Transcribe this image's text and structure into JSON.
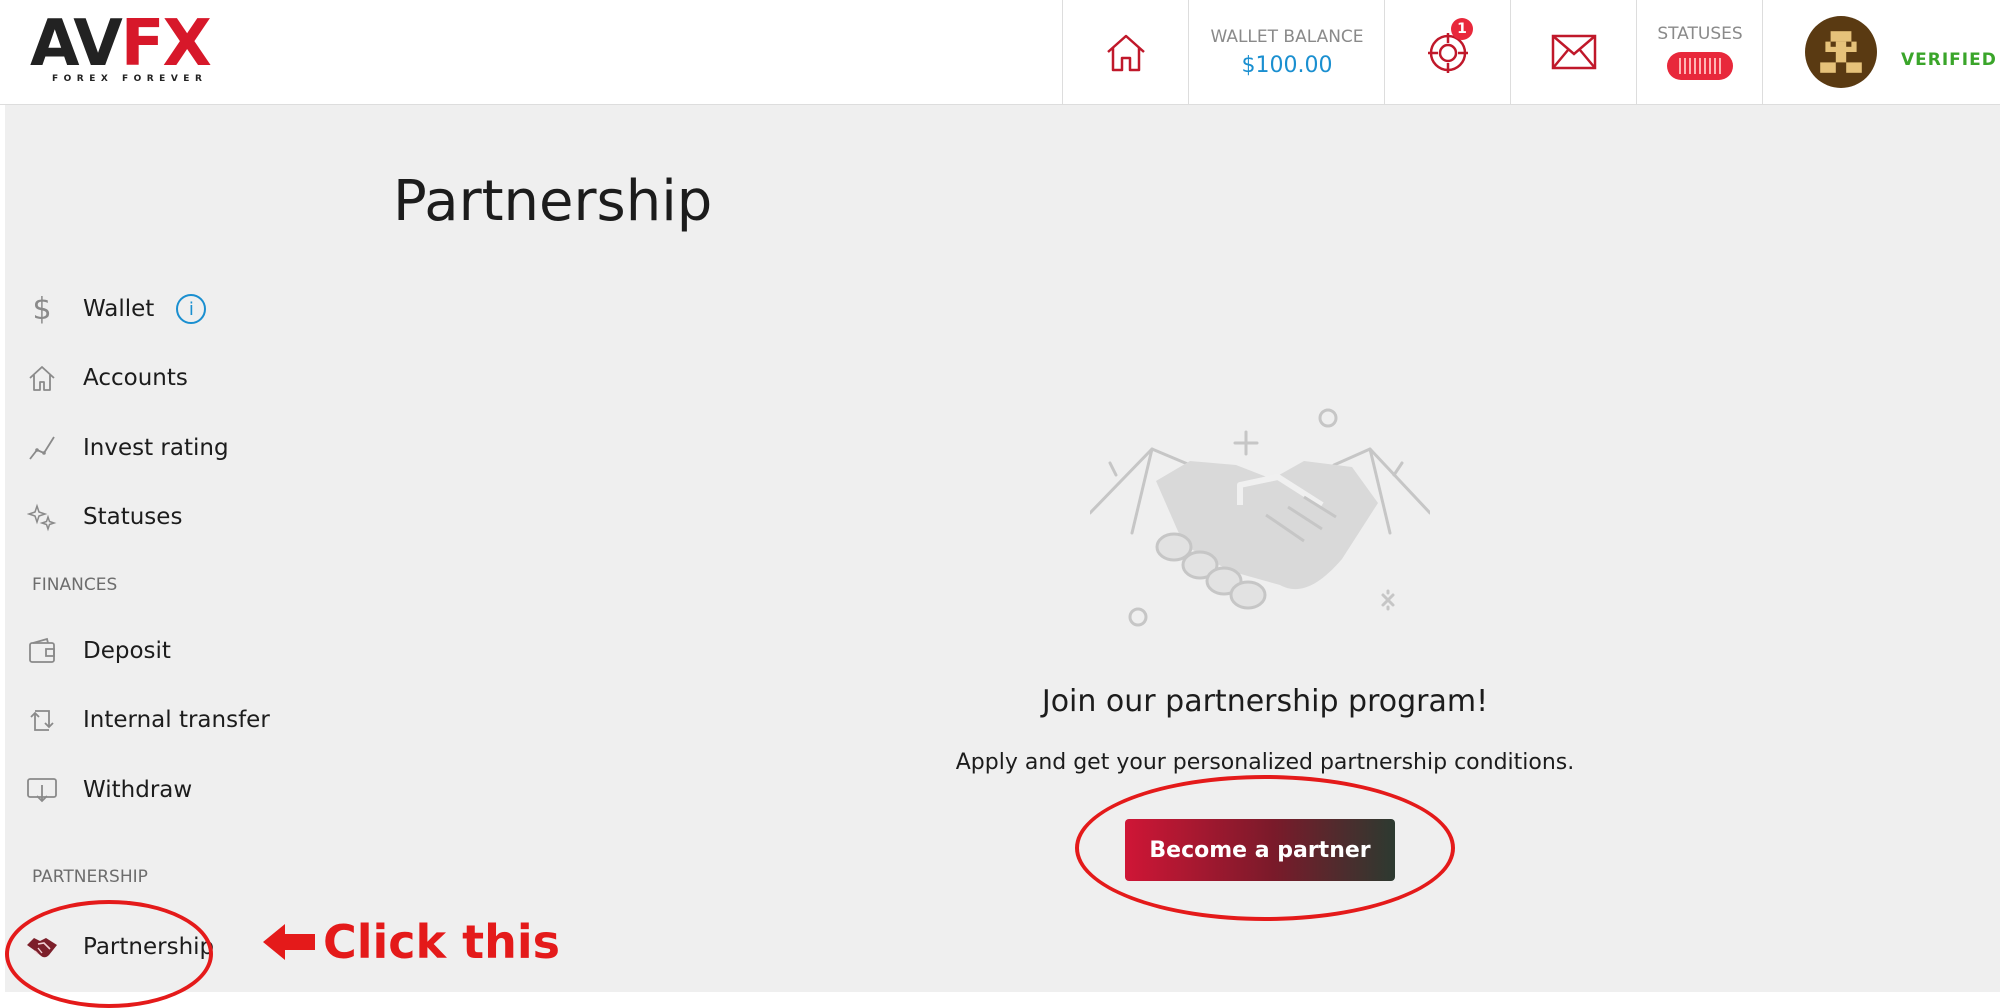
{
  "brand": {
    "logo_dark": "AV",
    "logo_red": "FX",
    "tagline": "FOREX FOREVER"
  },
  "header": {
    "wallet_label": "WALLET BALANCE",
    "wallet_amount": "$100.00",
    "notifications_count": "1",
    "statuses_label": "STATUSES",
    "verified_label": "VERIFIED"
  },
  "page": {
    "title": "Partnership"
  },
  "sidebar": {
    "items": [
      {
        "label": "Wallet",
        "icon": "dollar-icon"
      },
      {
        "label": "Accounts",
        "icon": "home-icon"
      },
      {
        "label": "Invest rating",
        "icon": "chart-line-icon"
      },
      {
        "label": "Statuses",
        "icon": "sparkle-icon"
      }
    ],
    "finances_label": "FINANCES",
    "finances_items": [
      {
        "label": "Deposit",
        "icon": "wallet-icon"
      },
      {
        "label": "Internal transfer",
        "icon": "transfer-icon"
      },
      {
        "label": "Withdraw",
        "icon": "withdraw-icon"
      }
    ],
    "partnership_label": "PARTNERSHIP",
    "partnership_items": [
      {
        "label": "Partnership",
        "icon": "handshake-icon"
      }
    ]
  },
  "main": {
    "join_title": "Join our partnership program!",
    "join_subtitle": "Apply and get your personalized partnership conditions.",
    "become_partner_label": "Become a partner"
  },
  "annotation": {
    "click_text": "Click this"
  },
  "colors": {
    "accent_red": "#d7182a",
    "wallet_blue": "#1a8fd0",
    "verified_green": "#3aa52a",
    "annotation_red": "#e41a1a"
  }
}
